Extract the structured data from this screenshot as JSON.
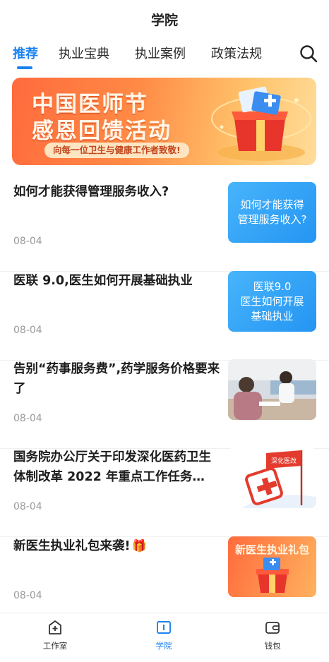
{
  "header": {
    "title": "学院"
  },
  "tabs": [
    {
      "label": "推荐"
    },
    {
      "label": "执业宝典"
    },
    {
      "label": "执业案例"
    },
    {
      "label": "政策法规"
    }
  ],
  "banner": {
    "line1": "中国医师节",
    "line2": "感恩回馈活动",
    "subtitle": "向每一位卫生与健康工作者致敬!"
  },
  "articles": [
    {
      "title": "如何才能获得管理服务收入?",
      "date": "08-04",
      "thumb_text": [
        "如何才能获得",
        "管理服务收入?"
      ]
    },
    {
      "title": "医联 9.0,医生如何开展基础执业",
      "date": "08-04",
      "thumb_text": [
        "医联9.0",
        "医生如何开展",
        "基础执业"
      ]
    },
    {
      "title": "告别“药事服务费”,药学服务价格要来了",
      "date": "08-04"
    },
    {
      "title": "国务院办公厅关于印发深化医药卫生体制改革 2022 年重点工作任务…",
      "date": "08-04",
      "thumb_flag": "深化医改"
    },
    {
      "title": "新医生执业礼包来袭!",
      "date": "08-04",
      "thumb_text": [
        "新医生执业礼包"
      ]
    }
  ],
  "bottom_nav": [
    {
      "label": "工作室",
      "icon": "studio-plus-icon"
    },
    {
      "label": "学院",
      "icon": "book-icon"
    },
    {
      "label": "钱包",
      "icon": "wallet-icon"
    }
  ],
  "colors": {
    "accent": "#1b82f0",
    "banner_start": "#ff6b3d",
    "banner_end": "#ffdc9a"
  }
}
